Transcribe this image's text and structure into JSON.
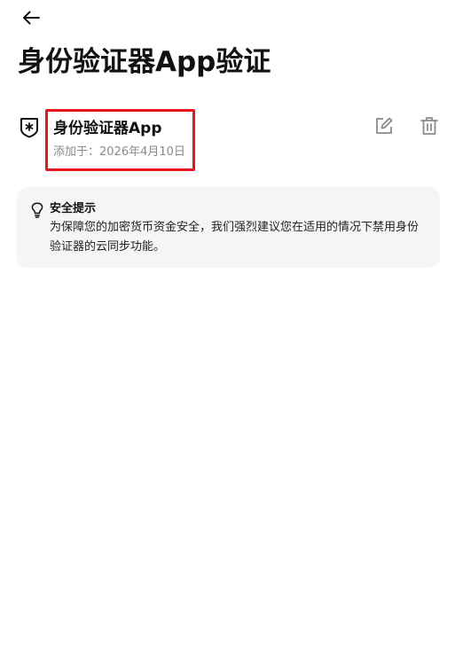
{
  "header": {
    "back_icon": "arrow-left-icon",
    "title": "身份验证器App验证"
  },
  "authenticator": {
    "icon": "shield-asterisk-icon",
    "name": "身份验证器App",
    "added_label": "添加于：",
    "added_date": "2026年4月10日",
    "edit_icon": "edit-pencil-icon",
    "delete_icon": "trash-icon",
    "highlight_color": "#e8151b"
  },
  "notice": {
    "icon": "lightbulb-icon",
    "title": "安全提示",
    "body": "为保障您的加密货币资金安全，我们强烈建议您在适用的情况下禁用身份验证器的云同步功能。",
    "background_color": "#f5f5f5"
  }
}
